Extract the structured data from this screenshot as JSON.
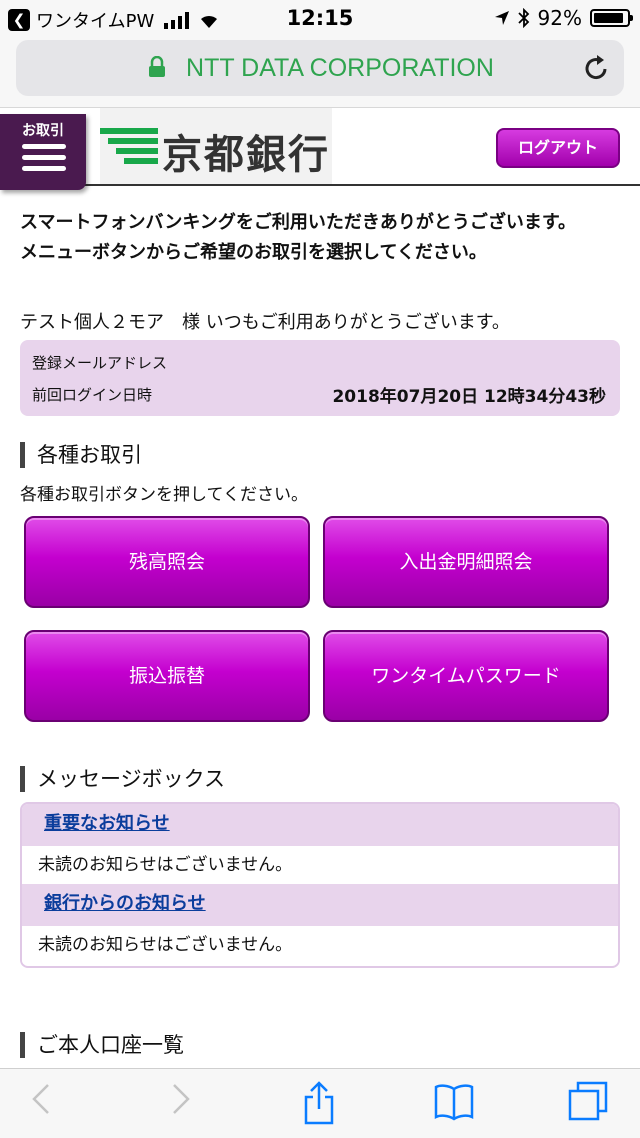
{
  "status_bar": {
    "back_app": "ワンタイムPW",
    "time": "12:15",
    "battery": "92%",
    "battery_level": 0.92
  },
  "browser": {
    "url_text": "NTT DATA CORPORATION"
  },
  "header": {
    "menu_label": "お取引",
    "logo_text": "京都銀行",
    "logout_label": "ログアウト"
  },
  "welcome": {
    "line1": "スマートフォンバンキングをご利用いただきありがとうございます。",
    "line2": "メニューボタンからご希望のお取引を選択してください。"
  },
  "greeting": "テスト個人２モア　様 いつもご利用ありがとうございます。",
  "info": {
    "email_label": "登録メールアドレス",
    "login_label": "前回ログイン日時",
    "login_value": "2018年07月20日 12時34分43秒"
  },
  "transactions": {
    "title": "各種お取引",
    "desc": "各種お取引ボタンを押してください。",
    "buttons": [
      "残高照会",
      "入出金明細照会",
      "振込振替",
      "ワンタイムパスワード"
    ]
  },
  "messages": {
    "title": "メッセージボックス",
    "items": [
      {
        "link": "重要なお知らせ",
        "body": "未読のお知らせはございません。"
      },
      {
        "link": "銀行からのお知らせ",
        "body": "未読のお知らせはございません。"
      }
    ]
  },
  "accounts": {
    "title": "ご本人口座一覧"
  },
  "colors": {
    "brand_purple": "#4a1a4f",
    "button_magenta": "#c400cf",
    "url_green": "#2fa44f",
    "logo_green": "#18a84a",
    "panel_lavender": "#e8d4ec"
  },
  "icons": [
    "lock-icon",
    "reload-icon",
    "back-icon",
    "forward-icon",
    "share-icon",
    "bookmarks-icon",
    "tabs-icon",
    "wifi-icon",
    "bluetooth-icon",
    "location-icon"
  ]
}
